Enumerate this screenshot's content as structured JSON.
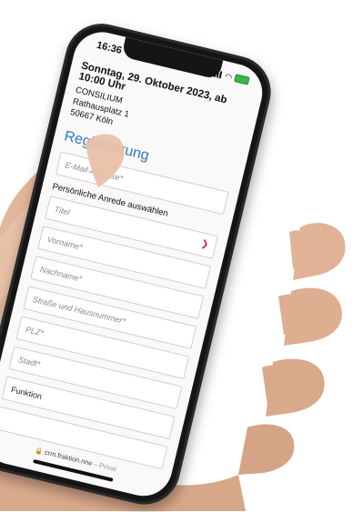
{
  "status_bar": {
    "time": "16:36"
  },
  "event": {
    "date_line": "Sonntag, 29. Oktober 2023, ab 10:00 Uhr",
    "venue": [
      "CONSILIUM",
      "Rathausplatz 1",
      "50667 Köln"
    ]
  },
  "form": {
    "title": "Registrierung",
    "email_placeholder": "E-Mail-Adresse*",
    "anrede_label": "Persönliche Anrede auswählen",
    "titel_placeholder": "Titel",
    "vorname_placeholder": "Vorname*",
    "nachname_placeholder": "Nachname*",
    "strasse_placeholder": "Straße und Hausnummer*",
    "plz_placeholder": "PLZ*",
    "stadt_placeholder": "Stadt*",
    "funktion_placeholder": "Funktion"
  },
  "browser": {
    "url": "crm.fraktion.nrw",
    "mode": "– Privat"
  },
  "colors": {
    "accent": "#2a7ac4",
    "chevron": "#d81b60",
    "battery": "#3bb54a"
  },
  "icons": {
    "chevron": "chevron-down-icon",
    "lock": "lock-icon"
  }
}
